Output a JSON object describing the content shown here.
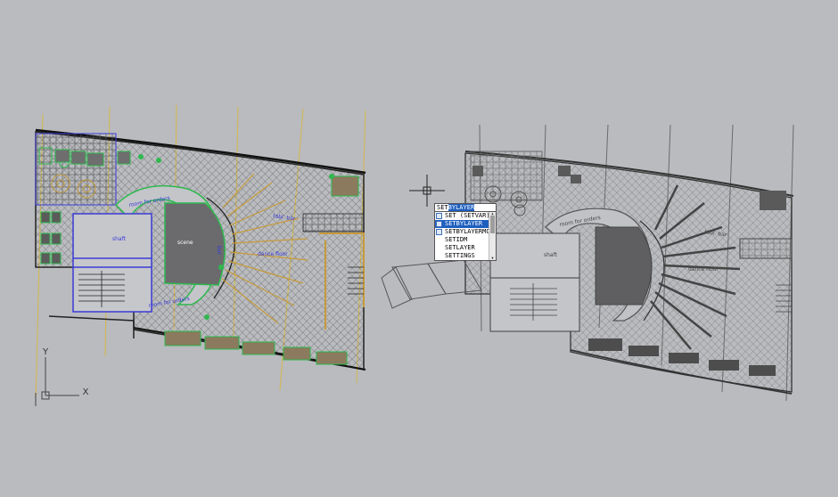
{
  "ucs": {
    "y_label": "Y",
    "x_label": "X"
  },
  "drawing_labels": {
    "room_for_orders": "room for orders",
    "shaft": "shaft",
    "scene": "scene",
    "bar": "bar",
    "dance_floor": "dance floor",
    "tabl_bar": "tabl. bar"
  },
  "command_line": {
    "typed": "SET",
    "autocomplete": "BYLAYER",
    "suggestions": [
      {
        "label": "SET (SETVAR)",
        "icon": "command-icon",
        "selected": false
      },
      {
        "label": "SETBYLAYER",
        "icon": "command-icon",
        "selected": true
      },
      {
        "label": "SETBYLAYERMODE",
        "icon": "variable-icon",
        "selected": false
      },
      {
        "label": "SETIDM",
        "icon": "",
        "selected": false
      },
      {
        "label": "SETLAYER",
        "icon": "",
        "selected": false
      },
      {
        "label": "SETTINGS",
        "icon": "",
        "selected": false
      }
    ]
  },
  "colors": {
    "background": "#b9bbbf",
    "selection": "#1e5fbf",
    "grid_line": "#d4b84a",
    "wall_blue": "#3b3bd6",
    "accent_green": "#2fb84e",
    "faded_line": "#6b6b6b"
  }
}
